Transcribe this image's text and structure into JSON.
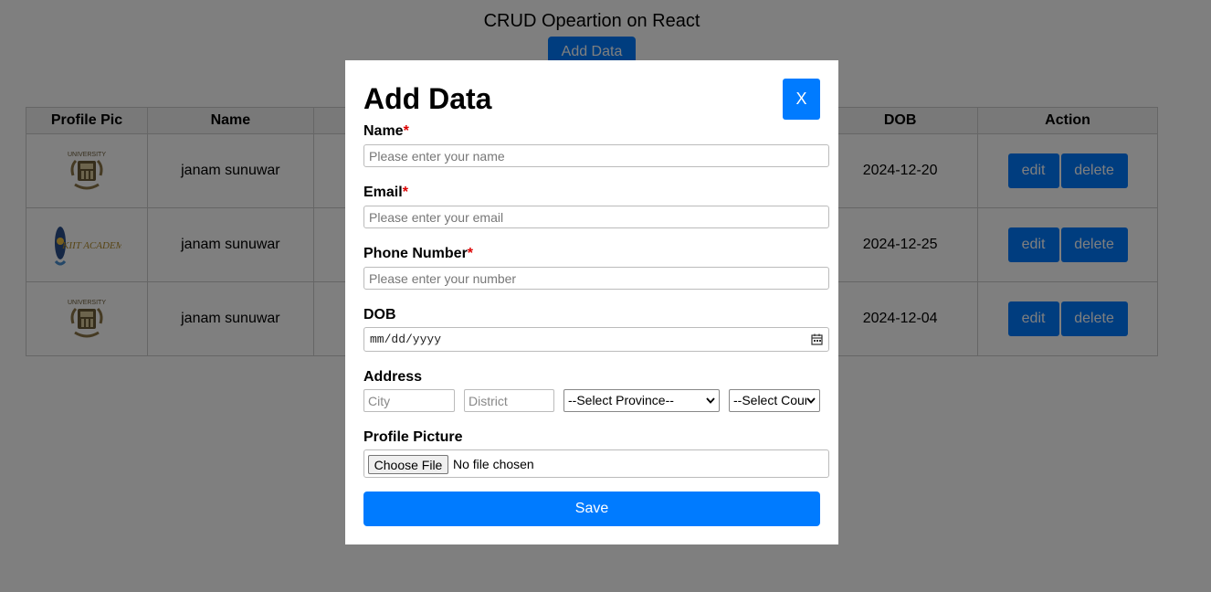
{
  "page": {
    "title": "CRUD Opeartion on React",
    "add_button": "Add Data"
  },
  "table": {
    "headers": [
      "Profile Pic",
      "Name",
      "",
      "DOB",
      "Action"
    ],
    "rows": [
      {
        "logo": "university-logo",
        "name": "janam sunuwar",
        "dob": "2024-12-20"
      },
      {
        "logo": "kiit-academy-logo",
        "logo_text": "KIIT ACADEMY",
        "name": "janam sunuwar",
        "dob": "2024-12-25"
      },
      {
        "logo": "university-logo",
        "name": "janam sunuwar",
        "dob": "2024-12-04"
      }
    ],
    "edit_label": "edit",
    "delete_label": "delete",
    "logo_text": "UNIVERSITY"
  },
  "modal": {
    "title": "Add Data",
    "close_label": "X",
    "required_mark": "*",
    "name_label": "Name",
    "name_placeholder": "Please enter your name",
    "email_label": "Email",
    "email_placeholder": "Please enter your email",
    "phone_label": "Phone Number",
    "phone_placeholder": "Please enter your number",
    "dob_label": "DOB",
    "dob_placeholder": "mm/dd/yyyy",
    "address_label": "Address",
    "city_placeholder": "City",
    "district_placeholder": "District",
    "province_selected": "--Select Province--",
    "country_selected": "--Select Cour",
    "profile_label": "Profile Picture",
    "file_button": "Choose File",
    "file_status": "No file chosen",
    "save_label": "Save"
  },
  "colors": {
    "accent": "#007bff",
    "overlay": "rgba(0,0,0,0.5)",
    "required": "#dd0000"
  }
}
